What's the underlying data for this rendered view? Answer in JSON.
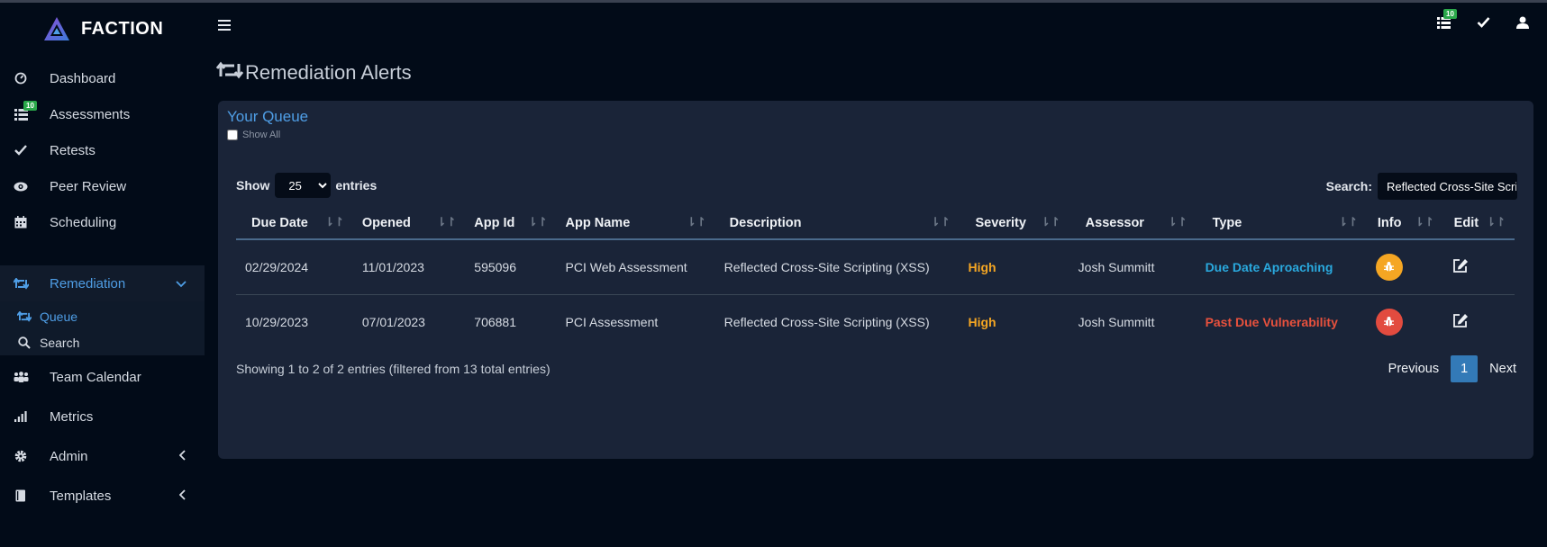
{
  "brand": {
    "name": "FACTION"
  },
  "sidebar": {
    "items": [
      {
        "label": "Dashboard",
        "icon": "dashboard-icon"
      },
      {
        "label": "Assessments",
        "icon": "list-icon",
        "badge": "10"
      },
      {
        "label": "Retests",
        "icon": "check-icon"
      },
      {
        "label": "Peer Review",
        "icon": "eye-icon"
      },
      {
        "label": "Scheduling",
        "icon": "calendar-icon"
      },
      {
        "label": "Remediation",
        "icon": "retweet-icon"
      },
      {
        "label": "Team Calendar",
        "icon": "team-icon"
      },
      {
        "label": "Metrics",
        "icon": "signal-icon"
      },
      {
        "label": "Admin",
        "icon": "gear-icon"
      },
      {
        "label": "Templates",
        "icon": "book-icon"
      }
    ],
    "sub_items": [
      {
        "label": "Queue",
        "icon": "retweet-icon"
      },
      {
        "label": "Search",
        "icon": "search-icon"
      }
    ]
  },
  "topbar": {
    "notification_badge": "10"
  },
  "page": {
    "title": "Remediation Alerts"
  },
  "card": {
    "title": "Your Queue",
    "show_all_label": "Show All",
    "show_label": "Show",
    "entries_label": "entries",
    "page_size": "25",
    "search_label": "Search:",
    "search_value": "Reflected Cross-Site Scripting (XSS)"
  },
  "table": {
    "columns": [
      "Due Date",
      "Opened",
      "App Id",
      "App Name",
      "Description",
      "Severity",
      "Assessor",
      "Type",
      "Info",
      "Edit"
    ],
    "rows": [
      {
        "due": "02/29/2024",
        "opened": "11/01/2023",
        "app_id": "595096",
        "app_name": "PCI Web Assessment",
        "description": "Reflected Cross-Site Scripting (XSS)",
        "severity": "High",
        "assessor": "Josh Summitt",
        "type": "Due Date Aproaching"
      },
      {
        "due": "10/29/2023",
        "opened": "07/01/2023",
        "app_id": "706881",
        "app_name": "PCI Assessment",
        "description": "Reflected Cross-Site Scripting (XSS)",
        "severity": "High",
        "assessor": "Josh Summitt",
        "type": "Past Due Vulnerability"
      }
    ]
  },
  "footer": {
    "info": "Showing 1 to 2 of 2 entries (filtered from 13 total entries)",
    "previous": "Previous",
    "current_page": "1",
    "next": "Next"
  },
  "colors": {
    "accent": "#4f9ee6",
    "high": "#f5a623",
    "due_approach": "#2aa9de",
    "past_due": "#e8513d"
  }
}
